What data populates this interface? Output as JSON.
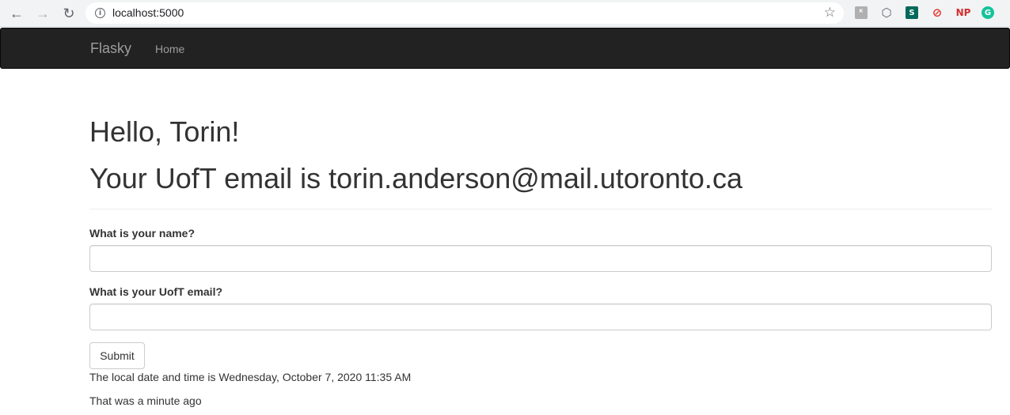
{
  "browser": {
    "url": "localhost:5000",
    "extensions": [
      {
        "name": "extension-1",
        "glyph": "ᴷ",
        "color": "#9e9e9e"
      },
      {
        "name": "extension-2",
        "glyph": "⬡",
        "color": "#5f6368"
      },
      {
        "name": "extension-3",
        "glyph": "S",
        "color": "#00695c"
      },
      {
        "name": "extension-4",
        "glyph": "⊘",
        "color": "#e53935"
      },
      {
        "name": "extension-np",
        "glyph": "NP",
        "color": "#d32f2f"
      },
      {
        "name": "extension-grammarly",
        "glyph": "G",
        "color": "#15c39a"
      }
    ]
  },
  "navbar": {
    "brand": "Flasky",
    "home": "Home"
  },
  "page": {
    "greeting": "Hello, Torin!",
    "email_line": "Your UofT email is torin.anderson@mail.utoronto.ca",
    "form": {
      "name_label": "What is your name?",
      "name_value": "",
      "email_label": "What is your UofT email?",
      "email_value": "",
      "submit_label": "Submit"
    },
    "local_time": "The local date and time is Wednesday, October 7, 2020 11:35 AM",
    "relative_time": "That was a minute ago"
  }
}
